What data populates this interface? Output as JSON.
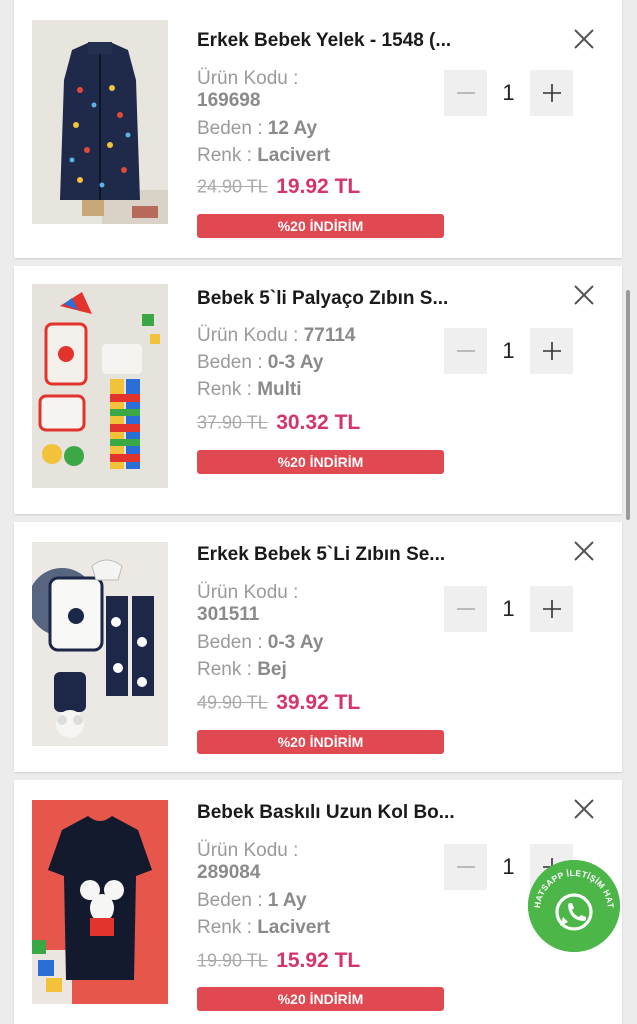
{
  "labels": {
    "code": "Ürün Kodu :",
    "size": "Beden :",
    "color": "Renk :"
  },
  "items": [
    {
      "title": "Erkek Bebek Yelek - 1548 (...",
      "code": "169698",
      "size": "12 Ay",
      "color": "Lacivert",
      "old_price": "24.90 TL",
      "new_price": "19.92 TL",
      "discount": "%20 İNDİRİM",
      "quantity": "1",
      "image_icon": "navy-vest-photo"
    },
    {
      "title": "Bebek 5`li Palyaço Zıbın S...",
      "code": "77114",
      "size": "0-3 Ay",
      "color": "Multi",
      "old_price": "37.90 TL",
      "new_price": "30.32 TL",
      "discount": "%20 İNDİRİM",
      "quantity": "1",
      "image_icon": "clown-set-photo"
    },
    {
      "title": "Erkek Bebek 5`Li Zıbın Se...",
      "code": "301511",
      "size": "0-3 Ay",
      "color": "Bej",
      "old_price": "49.90 TL",
      "new_price": "39.92 TL",
      "discount": "%20 İNDİRİM",
      "quantity": "1",
      "image_icon": "panda-set-photo"
    },
    {
      "title": "Bebek Baskılı Uzun Kol Bo...",
      "code": "289084",
      "size": "1 Ay",
      "color": "Lacivert",
      "old_price": "19.90 TL",
      "new_price": "15.92 TL",
      "discount": "%20 İNDİRİM",
      "quantity": "1",
      "image_icon": "mouse-bodysuit-photo"
    }
  ],
  "whatsapp": {
    "label": "WHATSAPP İLETİŞİM HATTI",
    "icon": "whatsapp-icon",
    "color": "#4cb648"
  },
  "colors": {
    "price": "#d6336c",
    "discount_bg": "#e04852",
    "stepper_bg": "#efefef"
  }
}
